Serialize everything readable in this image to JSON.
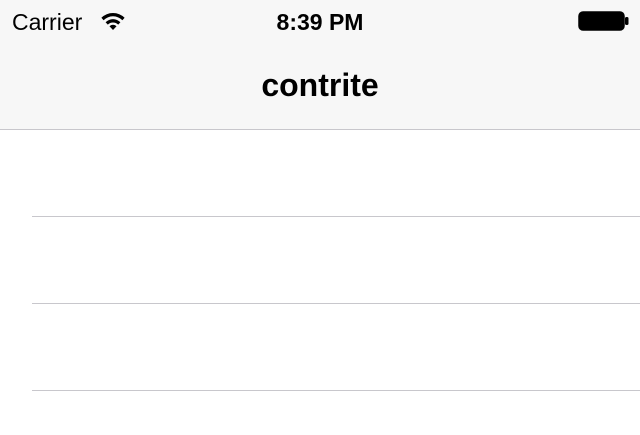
{
  "status_bar": {
    "carrier": "Carrier",
    "time": "8:39 PM",
    "wifi_icon": "wifi-icon",
    "battery_icon": "battery-full-icon"
  },
  "nav_bar": {
    "title": "contrite"
  },
  "table": {
    "rows": [
      {
        "label": ""
      },
      {
        "label": ""
      },
      {
        "label": ""
      }
    ]
  },
  "colors": {
    "nav_background": "#f7f7f7",
    "separator": "#c8c7cc",
    "text": "#000000"
  }
}
